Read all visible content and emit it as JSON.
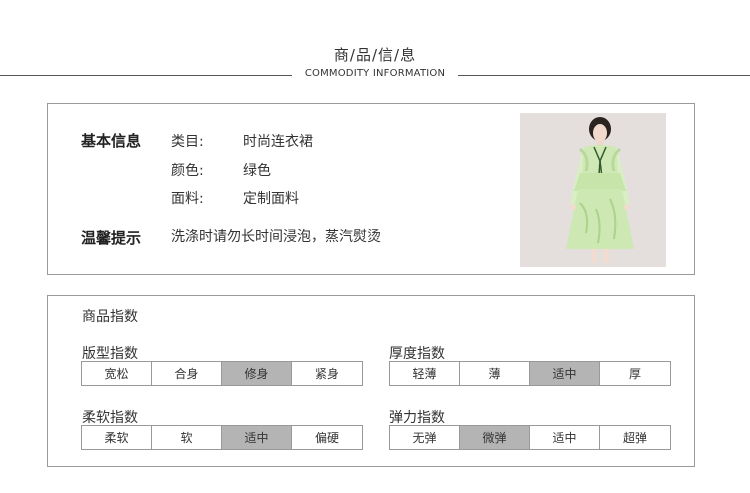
{
  "header": {
    "title": "商/品/信/息",
    "subtitle": "COMMODITY INFORMATION"
  },
  "basic_info": {
    "heading": "基本信息",
    "rows": [
      {
        "key": "类目:",
        "value": "时尚连衣裙"
      },
      {
        "key": "颜色:",
        "value": "绿色"
      },
      {
        "key": "面料:",
        "value": "定制面料"
      }
    ],
    "tip_heading": "温馨提示",
    "tip_text": "洗涤时请勿长时间浸泡，蒸汽熨烫"
  },
  "index": {
    "heading": "商品指数",
    "groups": [
      {
        "title": "版型指数",
        "options": [
          "宽松",
          "合身",
          "修身",
          "紧身"
        ],
        "selected": "修身"
      },
      {
        "title": "厚度指数",
        "options": [
          "轻薄",
          "薄",
          "适中",
          "厚"
        ],
        "selected": "适中"
      },
      {
        "title": "柔软指数",
        "options": [
          "柔软",
          "软",
          "适中",
          "偏硬"
        ],
        "selected": "适中"
      },
      {
        "title": "弹力指数",
        "options": [
          "无弹",
          "微弹",
          "适中",
          "超弹"
        ],
        "selected": "微弹"
      }
    ]
  },
  "colors": {
    "border": "#9a9a9a",
    "selected_cell": "#b4b4b4",
    "dress_green": "#c9e6b0"
  }
}
